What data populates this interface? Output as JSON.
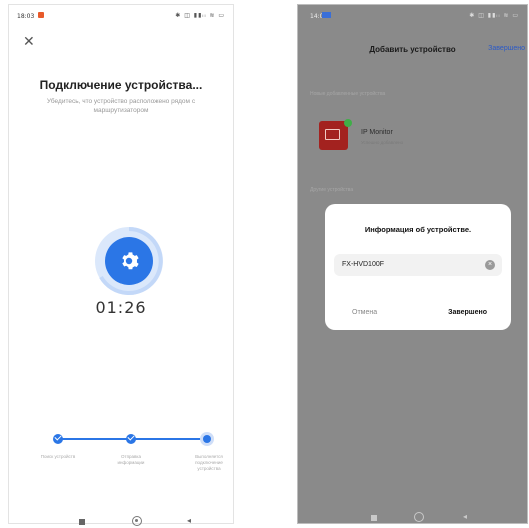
{
  "left_screen": {
    "status": {
      "time": "18:03",
      "right_icons": "✱ ◫ ▮▮ᵢₗ ≋ ▭"
    },
    "close_icon": "✕",
    "title": "Подключение устройства...",
    "subtitle": "Убедитесь, что устройство расположено рядом с маршрутизатором",
    "timer": "01:26",
    "steps": [
      {
        "label": "Поиск устройств",
        "state": "done"
      },
      {
        "label": "Отправка информации",
        "state": "done"
      },
      {
        "label": "Выполняется подключение устройства",
        "state": "active"
      }
    ],
    "colors": {
      "accent": "#2b76e6",
      "ring": "#dbe8fb"
    },
    "nav": {
      "back_glyph": "◂"
    }
  },
  "right_screen": {
    "status": {
      "time": "14:06",
      "right_icons": "✱ ◫ ▮▮ᵢₗ ≋ ▭"
    },
    "title": "Добавить устройство",
    "done_action": "Завершено",
    "section_added": "Новые добавленные устройства",
    "section_other": "Другие устройства",
    "device": {
      "name": "IP Monitor",
      "status": "Успешно добавлено",
      "icon": "monitor-icon",
      "badge": "check-icon"
    },
    "dialog": {
      "title": "Информация об устройстве.",
      "input_value": "FX-HVD100F",
      "clear_icon": "×",
      "cancel_label": "Отмена",
      "confirm_label": "Завершено"
    },
    "nav": {
      "back_glyph": "◂"
    }
  }
}
